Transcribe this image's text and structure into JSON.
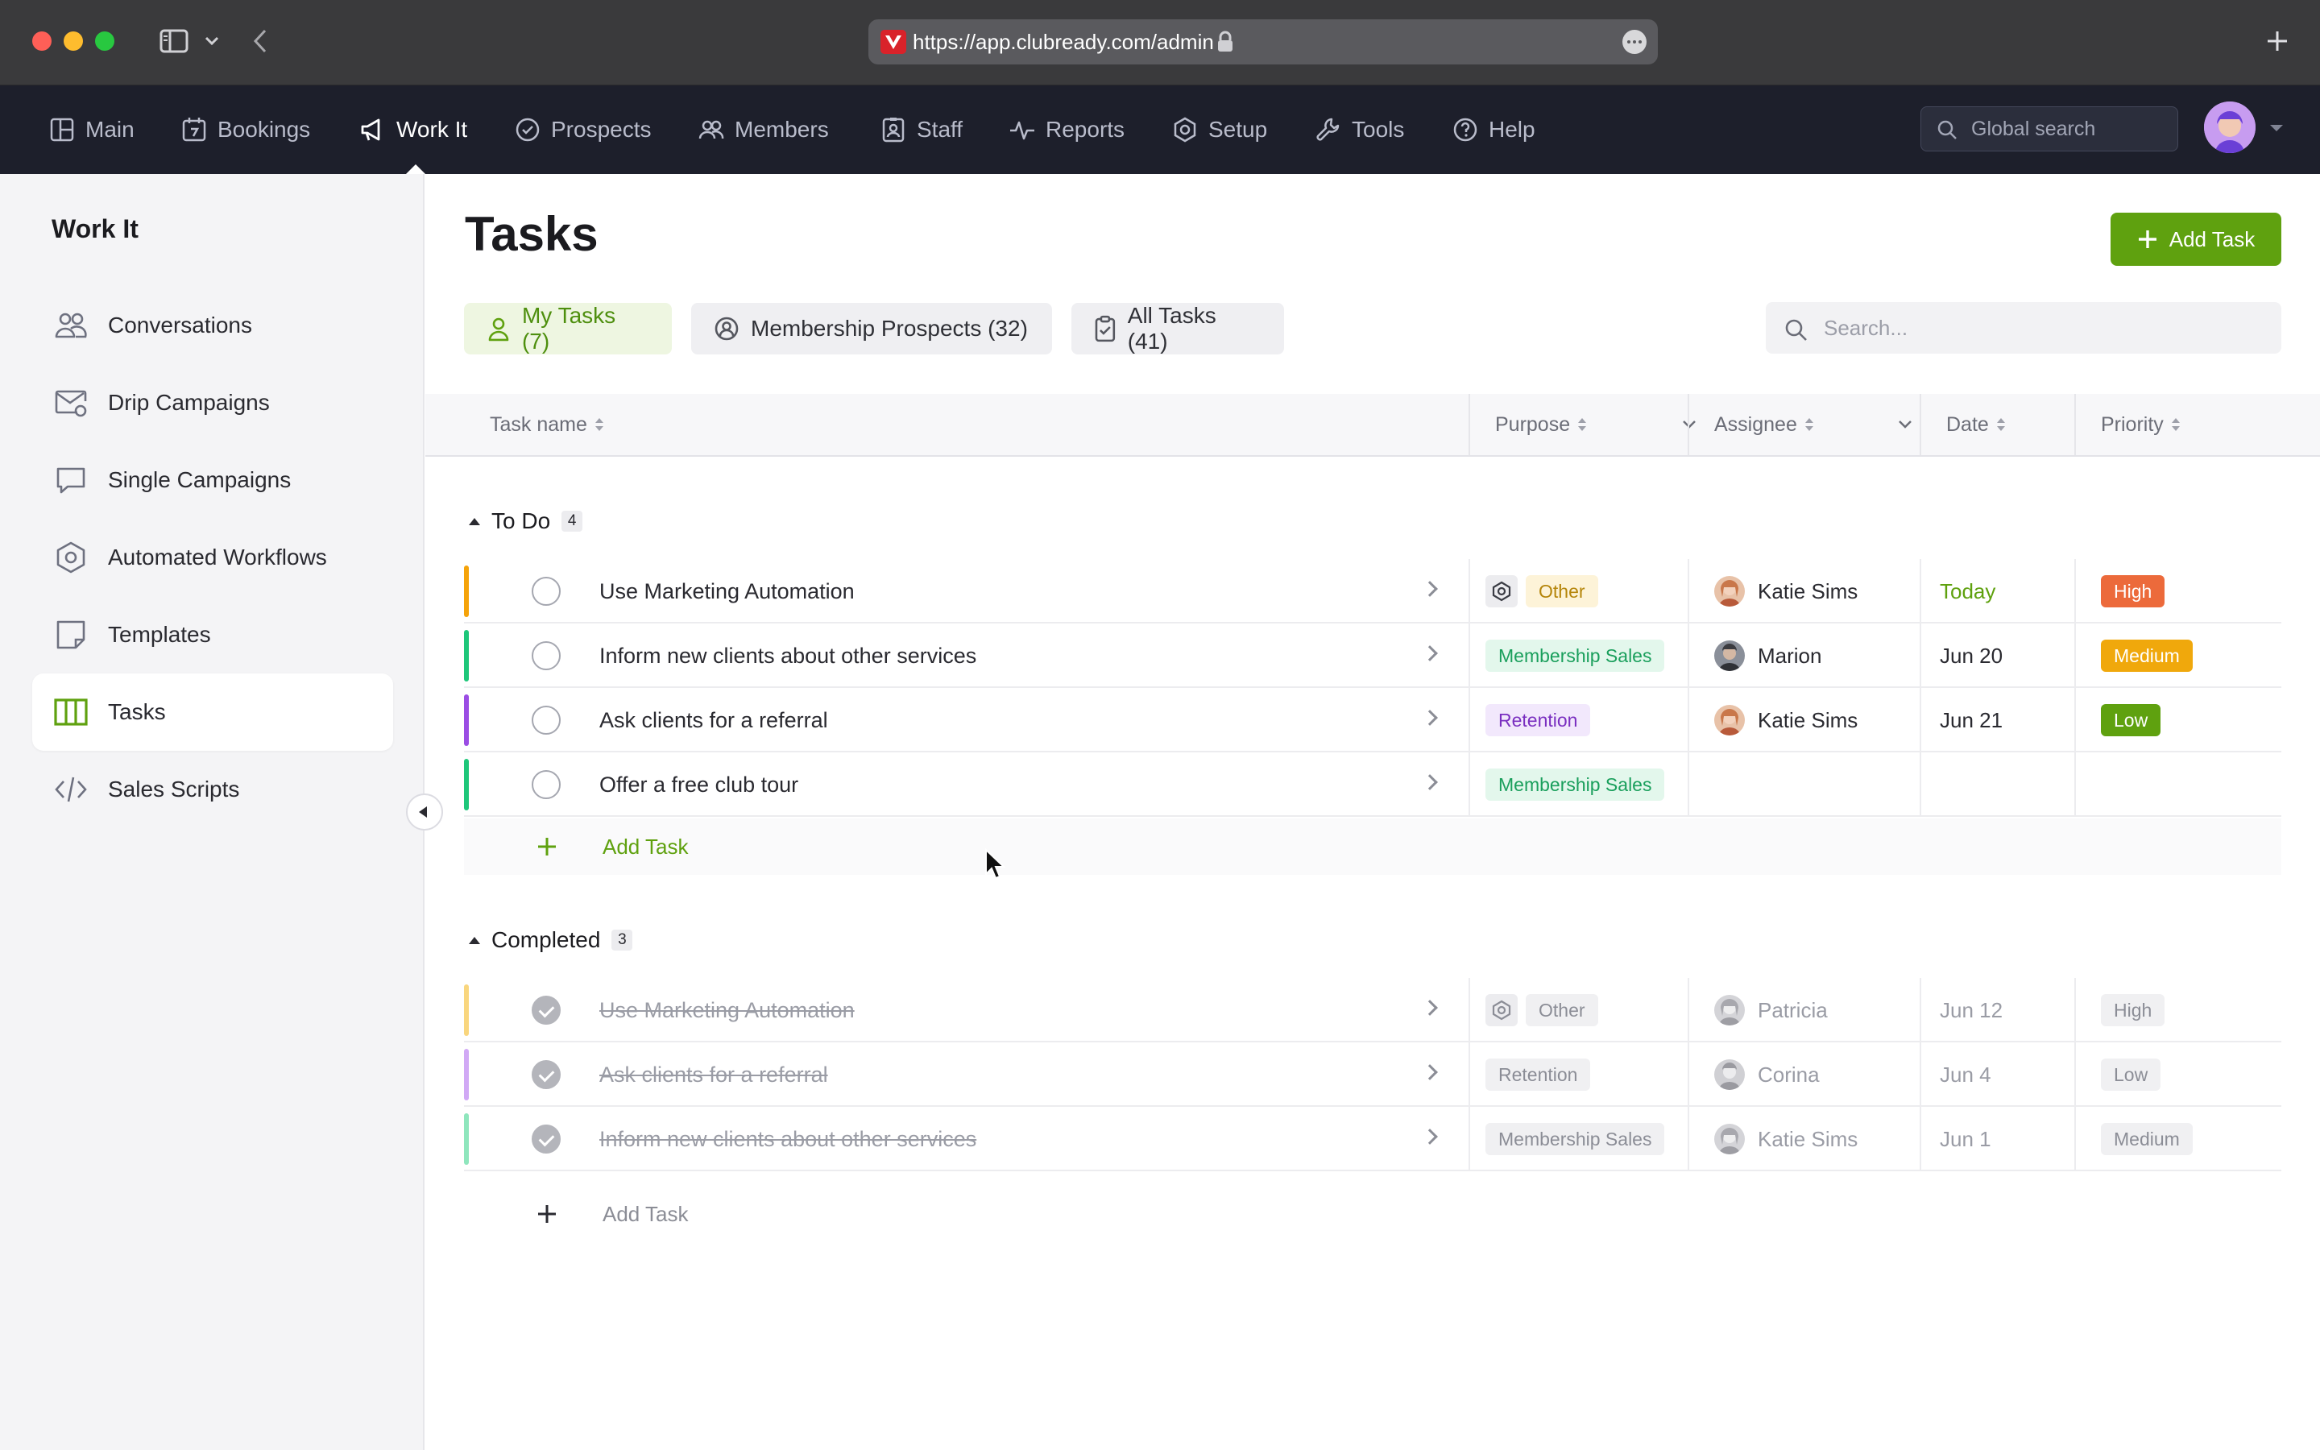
{
  "browser": {
    "url": "https://app.clubready.com/admin"
  },
  "nav": {
    "items": [
      {
        "label": "Main",
        "icon": "layout-icon"
      },
      {
        "label": "Bookings",
        "icon": "calendar-icon"
      },
      {
        "label": "Work It",
        "icon": "megaphone-icon",
        "active": true
      },
      {
        "label": "Prospects",
        "icon": "check-circle-icon"
      },
      {
        "label": "Members",
        "icon": "users-icon"
      },
      {
        "label": "Staff",
        "icon": "badge-icon"
      },
      {
        "label": "Reports",
        "icon": "pulse-icon"
      },
      {
        "label": "Setup",
        "icon": "gear-icon"
      },
      {
        "label": "Tools",
        "icon": "wrench-icon"
      },
      {
        "label": "Help",
        "icon": "help-icon"
      }
    ],
    "search_placeholder": "Global search"
  },
  "sidebar": {
    "title": "Work It",
    "items": [
      {
        "label": "Conversations",
        "icon": "users-icon"
      },
      {
        "label": "Drip Campaigns",
        "icon": "mail-settings-icon"
      },
      {
        "label": "Single Campaigns",
        "icon": "chat-icon"
      },
      {
        "label": "Automated Workflows",
        "icon": "hexagon-icon"
      },
      {
        "label": "Templates",
        "icon": "note-icon"
      },
      {
        "label": "Tasks",
        "icon": "kanban-icon",
        "active": true
      },
      {
        "label": "Sales Scripts",
        "icon": "code-icon"
      }
    ]
  },
  "main": {
    "title": "Tasks",
    "add_button": "Add Task",
    "filters": [
      {
        "label": "My Tasks (7)",
        "active": true
      },
      {
        "label": "Membership Prospects (32)"
      },
      {
        "label": "All Tasks (41)"
      }
    ],
    "search_placeholder": "Search...",
    "columns": {
      "task_name": "Task name",
      "purpose": "Purpose",
      "assignee": "Assignee",
      "date": "Date",
      "priority": "Priority"
    },
    "groups": {
      "todo": {
        "label": "To Do",
        "count": "4",
        "add_label": "Add Task",
        "rows": [
          {
            "name": "Use Marketing Automation",
            "purpose": "Other",
            "assignee": "Katie Sims",
            "date": "Today",
            "priority": "High"
          },
          {
            "name": "Inform new clients about other services",
            "purpose": "Membership Sales",
            "assignee": "Marion",
            "date": "Jun 20",
            "priority": "Medium"
          },
          {
            "name": "Ask clients for a referral",
            "purpose": "Retention",
            "assignee": "Katie Sims",
            "date": "Jun 21",
            "priority": "Low"
          },
          {
            "name": "Offer a free club tour",
            "purpose": "Membership Sales",
            "assignee": "",
            "date": "",
            "priority": ""
          }
        ]
      },
      "completed": {
        "label": "Completed",
        "count": "3",
        "add_label": "Add Task",
        "rows": [
          {
            "name": "Use Marketing Automation",
            "purpose": "Other",
            "assignee": "Patricia",
            "date": "Jun 12",
            "priority": "High"
          },
          {
            "name": "Ask clients for a referral",
            "purpose": "Retention",
            "assignee": "Corina",
            "date": "Jun 4",
            "priority": "Low"
          },
          {
            "name": "Inform new clients about other services",
            "purpose": "Membership Sales",
            "assignee": "Katie Sims",
            "date": "Jun 1",
            "priority": "Medium"
          }
        ]
      }
    }
  },
  "colors": {
    "accent_green": "#5fa10f",
    "nav_bg": "#1d1f2b",
    "bar_orange": "#f5a30a",
    "bar_green": "#1ec77a",
    "bar_purple": "#9b4de4",
    "prio_high": "#ec6a3b",
    "prio_medium": "#f0a80c",
    "prio_low": "#5fa10f"
  }
}
